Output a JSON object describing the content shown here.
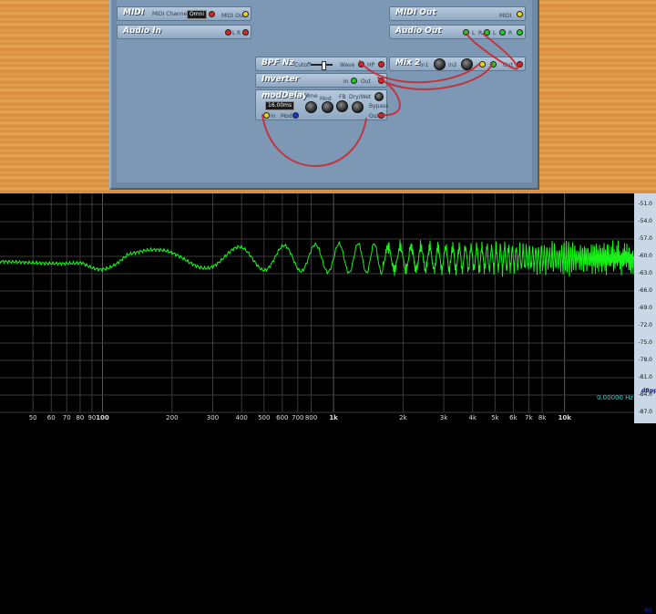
{
  "modules": {
    "midi": {
      "title": "MIDI",
      "channel_label": "MIDI Channel",
      "channel_value": "Omni",
      "out_label": "MIDI Out"
    },
    "audio_in": {
      "title": "Audio In",
      "l": "L",
      "r": "R"
    },
    "midi_out": {
      "title": "MIDI Out",
      "in_label": "MIDI"
    },
    "audio_out": {
      "title": "Audio Out",
      "l1": "L",
      "r1": "R",
      "l2": "L",
      "r2": "R"
    },
    "bpf": {
      "title": "BPF Nz",
      "cutoff_label": "Cutoff",
      "wave_label": "Wave",
      "hp_label": "HP"
    },
    "mix2": {
      "title": "Mix 2",
      "in1": "In1",
      "in2": "In2",
      "out": "Out"
    },
    "inverter": {
      "title": "Inverter",
      "in": "In",
      "out": "Out"
    },
    "moddelay": {
      "title": "modDelay",
      "time_value": "16.00ms",
      "time_label": "Time",
      "mod_label": "Mod",
      "fb_label": "FB",
      "drywet_label": "Dry/Wet",
      "bypass_label": "Bypass",
      "in_label": "In",
      "mod_in_label": "Mod",
      "out_label": "Out"
    }
  },
  "analyzer": {
    "readout": "0.00000 Hz",
    "y_unit": "dBpp",
    "x_unit": "Hz",
    "y_ticks": [
      "-51.0",
      "-54.0",
      "-57.0",
      "-60.0",
      "-63.0",
      "-66.0",
      "-69.0",
      "-72.0",
      "-75.0",
      "-78.0",
      "-81.0",
      "-84.0",
      "-87.0"
    ],
    "x_ticks": [
      "50",
      "60",
      "70",
      "80",
      "90",
      "100",
      "200",
      "300",
      "400",
      "500",
      "600",
      "700",
      "800",
      "1k",
      "2k",
      "3k",
      "4k",
      "5k",
      "6k",
      "7k",
      "8k",
      "10k"
    ],
    "trace_color": "#19f219",
    "grid_color": "#3a3a3a"
  }
}
